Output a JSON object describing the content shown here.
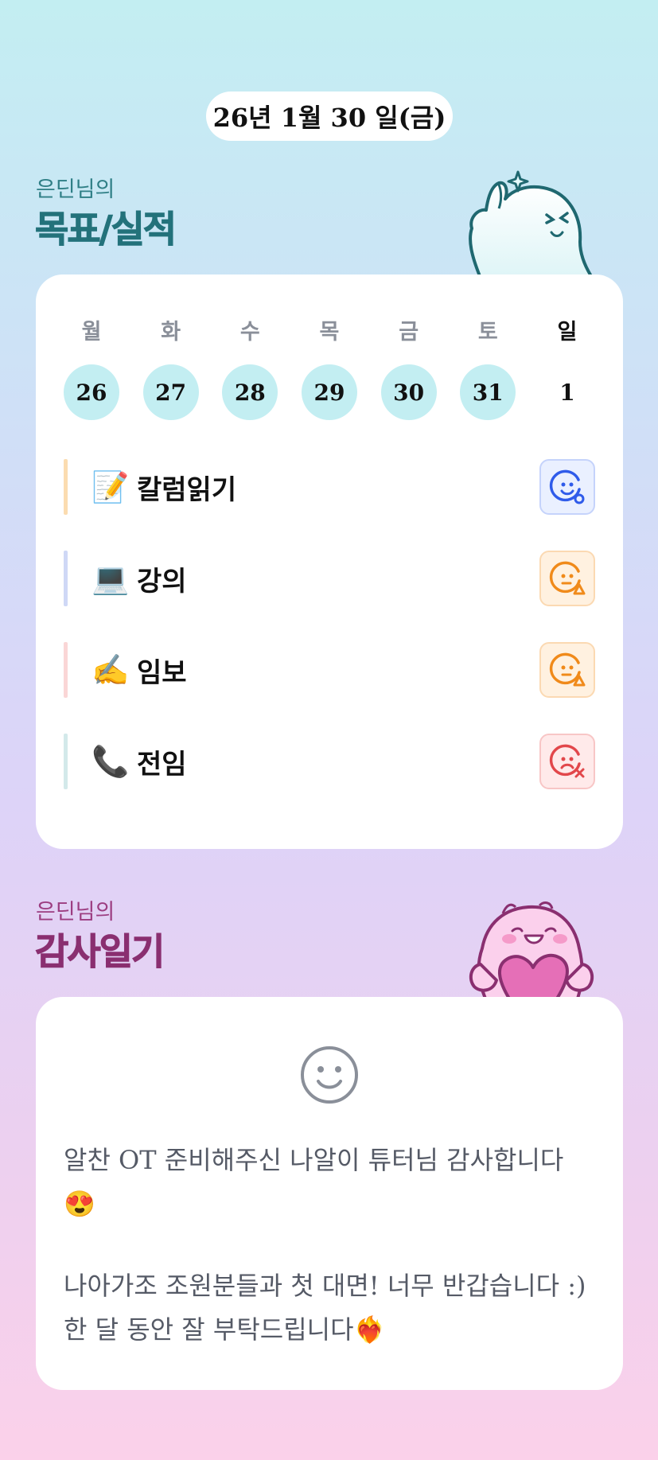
{
  "date": "26년 1월 30 일(금)",
  "goals_section": {
    "subtitle": "은딘님의",
    "title": "목표/실적"
  },
  "week": {
    "days_of_week": [
      "월",
      "화",
      "수",
      "목",
      "금",
      "토",
      "일"
    ],
    "dates": [
      "26",
      "27",
      "28",
      "29",
      "30",
      "31",
      "1"
    ],
    "completed": [
      true,
      true,
      true,
      true,
      true,
      true,
      false
    ]
  },
  "goals": [
    {
      "emoji": "📝",
      "label": "칼럼읽기",
      "status": "good",
      "bar_color": "#fbdcb0"
    },
    {
      "emoji": "💻",
      "label": "강의",
      "status": "partial",
      "bar_color": "#cfd8f6"
    },
    {
      "emoji": "✍️",
      "label": "임보",
      "status": "partial",
      "bar_color": "#fad6d6"
    },
    {
      "emoji": "📞",
      "label": "전임",
      "status": "fail",
      "bar_color": "#d3e9ea"
    }
  ],
  "thanks_section": {
    "subtitle": "은딘님의",
    "title": "감사일기"
  },
  "thanks_entry": {
    "paragraph_1": "알찬 OT 준비해주신 나알이 튜터님 감사합니다\n😍",
    "paragraph_2": "나아가조 조원분들과 첫 대면! 너무 반갑습니다 :)\n한 달 동안 잘 부탁드립니다❤️‍🔥"
  },
  "colors": {
    "accent_teal": "#23727b",
    "accent_plum": "#8a2f70",
    "completed_day": "#c3eef2",
    "status_good": "#2f5bea",
    "status_partial": "#f08a1a",
    "status_fail": "#e2474b"
  },
  "icons": {
    "status_good": "smile-circle-icon",
    "status_partial": "neutral-triangle-icon",
    "status_fail": "frown-x-icon",
    "thanks_header": "smiley-face-icon"
  }
}
